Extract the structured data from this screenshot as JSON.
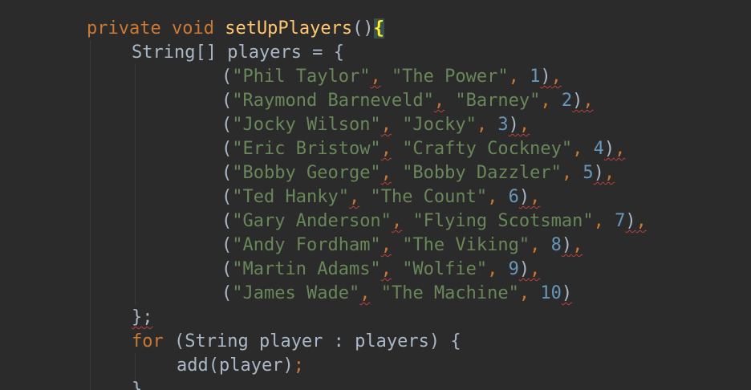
{
  "method": {
    "modifier": "private",
    "return_type": "void",
    "name": "setUpPlayers",
    "params": "()",
    "open_brace": "{"
  },
  "array_decl": {
    "type": "String[]",
    "name": "players",
    "assign": " = ",
    "open_brace": "{"
  },
  "players": [
    {
      "name": "\"Phil Taylor\"",
      "nickname": "\"The Power\"",
      "rank": "1",
      "tail": ")"
    },
    {
      "name": "\"Raymond Barneveld\"",
      "nickname": "\"Barney\"",
      "rank": "2",
      "tail": ")"
    },
    {
      "name": "\"Jocky Wilson\"",
      "nickname": "\"Jocky\"",
      "rank": "3",
      "tail": ")"
    },
    {
      "name": "\"Eric Bristow\"",
      "nickname": "\"Crafty Cockney\"",
      "rank": "4",
      "tail": ")"
    },
    {
      "name": "\"Bobby George\"",
      "nickname": "\"Bobby Dazzler\"",
      "rank": "5",
      "tail": ")"
    },
    {
      "name": "\"Ted Hanky\"",
      "nickname": "\"The Count\"",
      "rank": "6",
      "tail": ")"
    },
    {
      "name": "\"Gary Anderson\"",
      "nickname": "\"Flying Scotsman\"",
      "rank": "7",
      "tail": ")"
    },
    {
      "name": "\"Andy Fordham\"",
      "nickname": "\"The Viking\"",
      "rank": "8",
      "tail": ")"
    },
    {
      "name": "\"Martin Adams\"",
      "nickname": "\"Wolfie\"",
      "rank": "9",
      "tail": ")"
    },
    {
      "name": "\"James Wade\"",
      "nickname": "\"The Machine\"",
      "rank": "10",
      "tail": ")"
    }
  ],
  "array_close": "};",
  "for_loop": {
    "keyword": "for",
    "header": " (String player : players) {"
  },
  "body": {
    "call": "add(player)",
    "semi": ";"
  },
  "closing": "}",
  "colors": {
    "background": "#2b2b2b",
    "keyword": "#cc7832",
    "function": "#ffc66d",
    "string": "#6a8759",
    "number": "#6897bb",
    "text": "#a9b7c6",
    "error": "#bc3f3c"
  }
}
